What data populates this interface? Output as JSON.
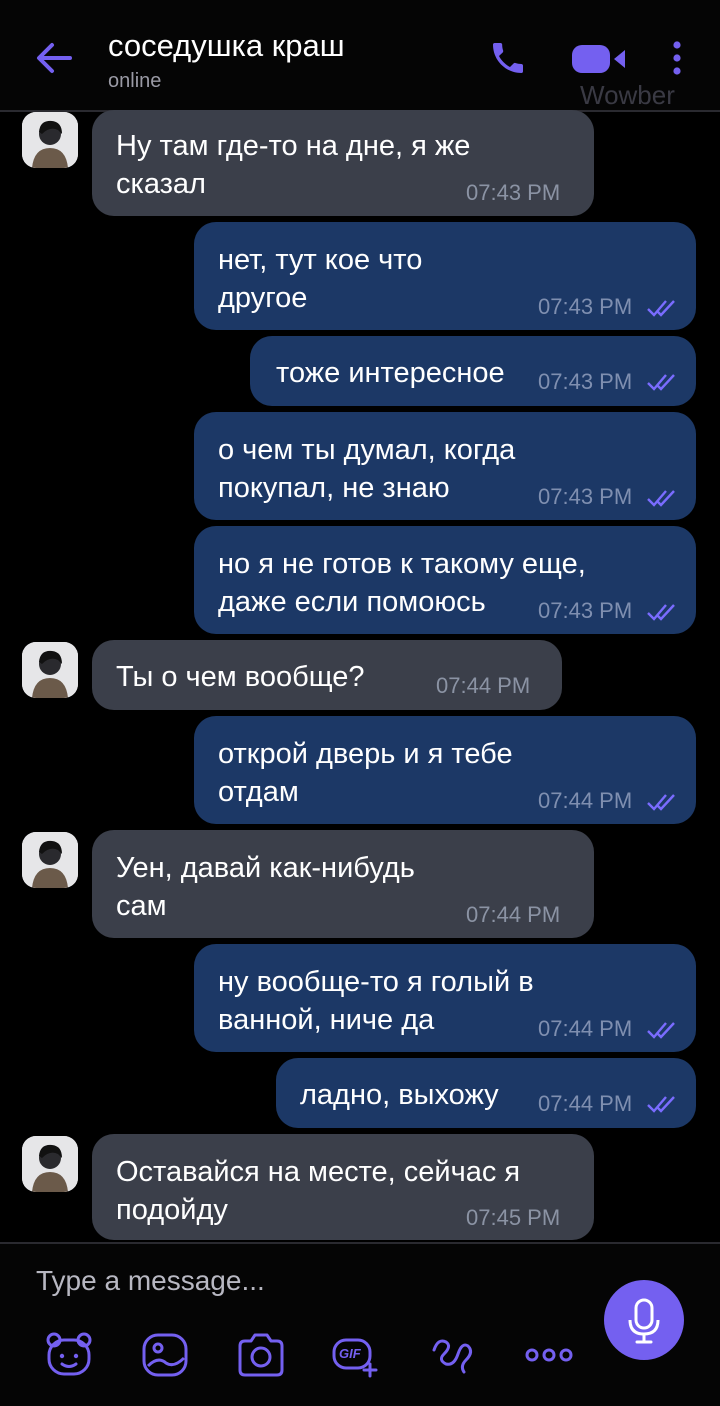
{
  "header": {
    "contact_name": "соседушка краш",
    "status": "online",
    "watermark": "Wowber",
    "icons": [
      "back-arrow-icon",
      "phone-icon",
      "video-call-icon",
      "more-vert-icon"
    ]
  },
  "colors": {
    "accent": "#7460f0",
    "incoming_bubble": "#3b3f4a",
    "outgoing_bubble": "#1c3866",
    "read_ticks": "#7a6cff"
  },
  "messages": [
    {
      "direction": "in",
      "text": "Ну там где-то на дне, я же\nсказал",
      "time": "07:43 PM"
    },
    {
      "direction": "out",
      "text": "нет, тут кое что\nдругое",
      "time": "07:43 PM",
      "read": true
    },
    {
      "direction": "out",
      "text": "тоже интересное",
      "time": "07:43 PM",
      "read": true
    },
    {
      "direction": "out",
      "text": "о чем ты думал, когда\nпокупал, не знаю",
      "time": "07:43 PM",
      "read": true
    },
    {
      "direction": "out",
      "text": "но я не готов к такому еще,\nдаже если помоюсь",
      "time": "07:43 PM",
      "read": true
    },
    {
      "direction": "in",
      "text": "Ты о чем вообще?",
      "time": "07:44 PM"
    },
    {
      "direction": "out",
      "text": "открой дверь и я тебе\nотдам",
      "time": "07:44 PM",
      "read": true
    },
    {
      "direction": "in",
      "text": "Уен, давай как-нибудь\nсам",
      "time": "07:44 PM"
    },
    {
      "direction": "out",
      "text": "ну вообще-то я голый в\nванной, ниче да",
      "time": "07:44 PM",
      "read": true
    },
    {
      "direction": "out",
      "text": "ладно, выхожу",
      "time": "07:44 PM",
      "read": true
    },
    {
      "direction": "in",
      "text": "Оставайся на месте, сейчас я\nподойду",
      "time": "07:45 PM"
    }
  ],
  "composer": {
    "placeholder": "Type a message...",
    "gif_label": "GIF",
    "tools": [
      "sticker-bear-icon",
      "gallery-icon",
      "camera-icon",
      "gif-icon",
      "doodle-icon",
      "more-options-icon"
    ],
    "send_icon": "microphone-icon"
  }
}
